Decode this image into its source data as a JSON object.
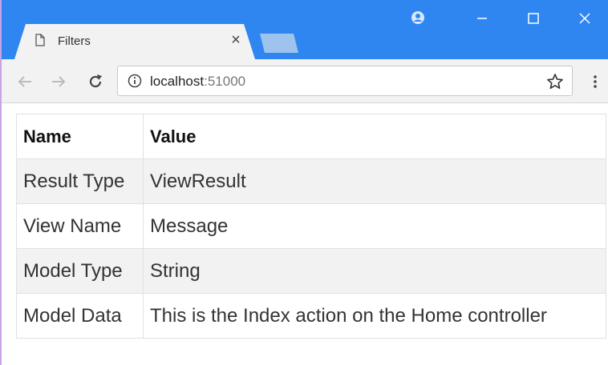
{
  "browser": {
    "tab_title": "Filters",
    "tab_close": "×",
    "url_host": "localhost",
    "url_port": ":51000",
    "accent_color": "#2f86f0"
  },
  "table": {
    "headers": [
      "Name",
      "Value"
    ],
    "rows": [
      {
        "name": "Result Type",
        "value": "ViewResult"
      },
      {
        "name": "View Name",
        "value": "Message"
      },
      {
        "name": "Model Type",
        "value": "String"
      },
      {
        "name": "Model Data",
        "value": "This is the Index action on the Home controller"
      }
    ]
  },
  "icons": {
    "tab": "document-icon",
    "back": "back-arrow-icon",
    "forward": "forward-arrow-icon",
    "reload": "reload-icon",
    "info": "info-icon",
    "bookmark": "star-icon",
    "menu": "more-vert-icon",
    "profile": "profile-icon",
    "minimize": "minimize-icon",
    "maximize": "maximize-icon",
    "close": "close-icon"
  }
}
